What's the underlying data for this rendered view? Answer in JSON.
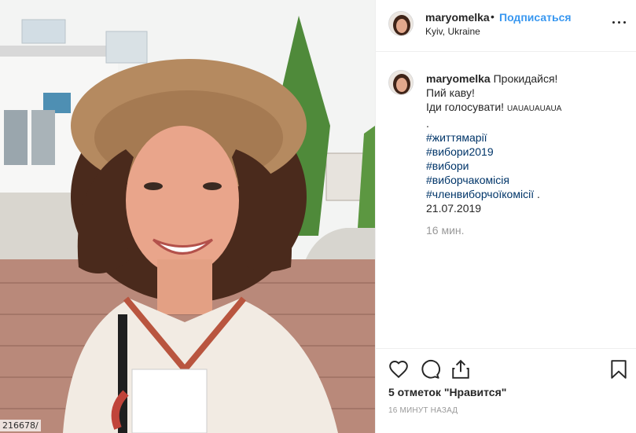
{
  "photo": {
    "description_icon": "post-photo",
    "corner_id": "216678/"
  },
  "header": {
    "username": "maryomelka",
    "separator": "•",
    "follow_label": "Подписаться",
    "location": "Kyiv, Ukraine"
  },
  "caption": {
    "username": "maryomelka",
    "first_line": "Прокидайся!",
    "lines": [
      "Пий каву!",
      "Іди голосувати!"
    ],
    "emoji_text": "UAUAUAUAUA",
    "dot": ".",
    "hashtags": [
      "#життямарії",
      "#вибори2019",
      "#вибори",
      "#виборчакомісія",
      "#членвиборчоїкомісії"
    ],
    "tag_suffix": " .",
    "date": "21.07.2019"
  },
  "time_ago": "16 мин.",
  "actions": {
    "likes": "5 отметок \"Нравится\"",
    "timestamp": "16 МИНУТ НАЗАД"
  },
  "colors": {
    "link": "#3897f0",
    "hashtag": "#003569",
    "muted": "#999999",
    "text": "#262626"
  }
}
